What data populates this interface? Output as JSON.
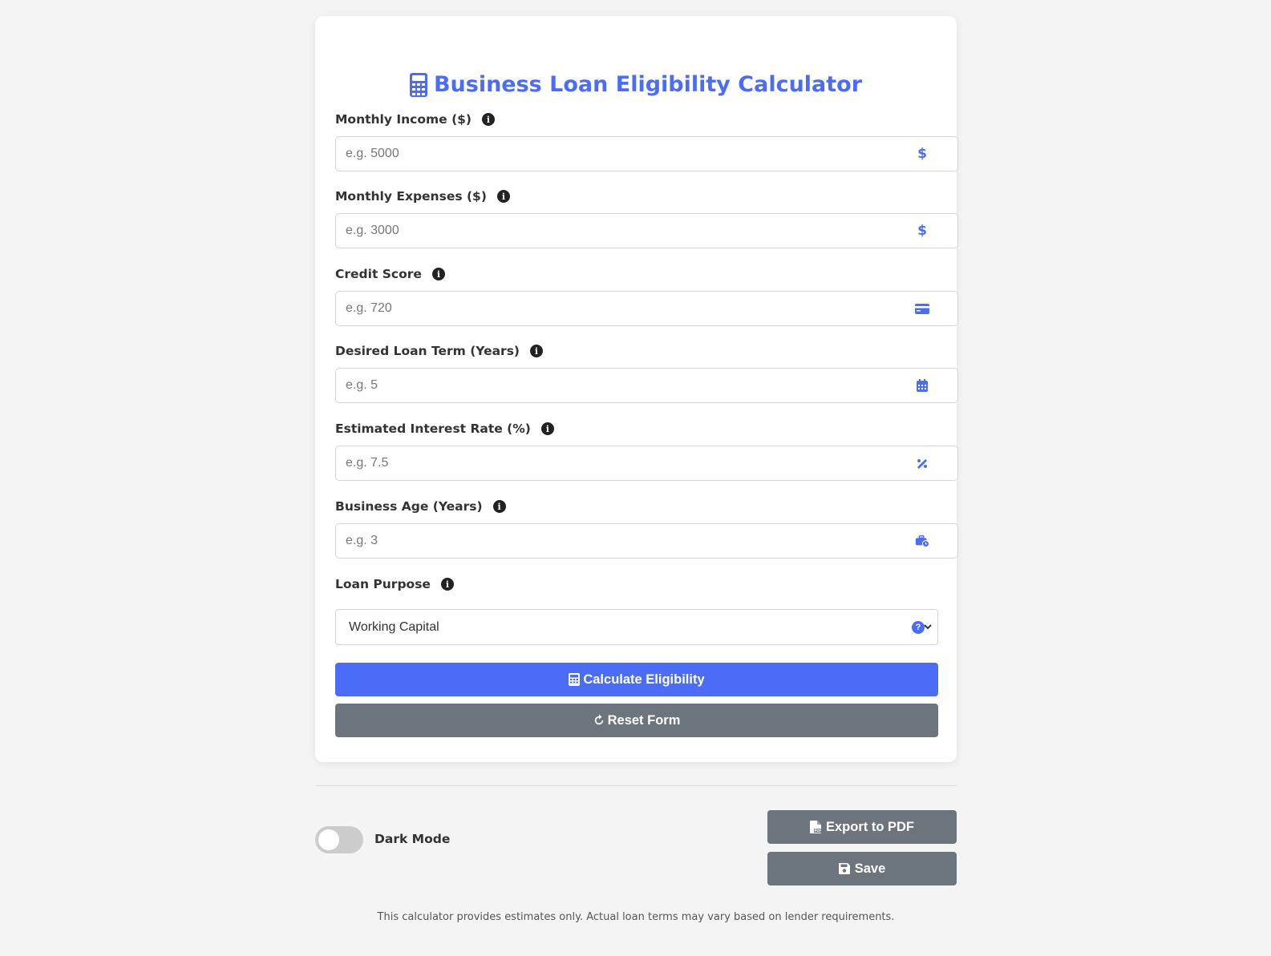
{
  "title": "Business Loan Eligibility Calculator",
  "fields": [
    {
      "label": "Monthly Income ($)",
      "placeholder": "e.g. 5000",
      "icon": "dollar-icon"
    },
    {
      "label": "Monthly Expenses ($)",
      "placeholder": "e.g. 3000",
      "icon": "dollar-icon"
    },
    {
      "label": "Credit Score",
      "placeholder": "e.g. 720",
      "icon": "credit-card-icon"
    },
    {
      "label": "Desired Loan Term (Years)",
      "placeholder": "e.g. 5",
      "icon": "calendar-icon"
    },
    {
      "label": "Estimated Interest Rate (%)",
      "placeholder": "e.g. 7.5",
      "icon": "percent-icon"
    },
    {
      "label": "Business Age (Years)",
      "placeholder": "e.g. 3",
      "icon": "briefcase-clock-icon"
    }
  ],
  "loan_purpose": {
    "label": "Loan Purpose",
    "selected": "Working Capital"
  },
  "buttons": {
    "calculate": "Calculate Eligibility",
    "reset": "Reset Form",
    "export": "Export to PDF",
    "save": "Save"
  },
  "dark_mode": {
    "label": "Dark Mode",
    "enabled": false
  },
  "disclaimer": "This calculator provides estimates only. Actual loan terms may vary based on lender requirements.",
  "colors": {
    "primary": "#4a6cf7",
    "secondary": "#6c757d",
    "background": "#f4f4f4"
  }
}
